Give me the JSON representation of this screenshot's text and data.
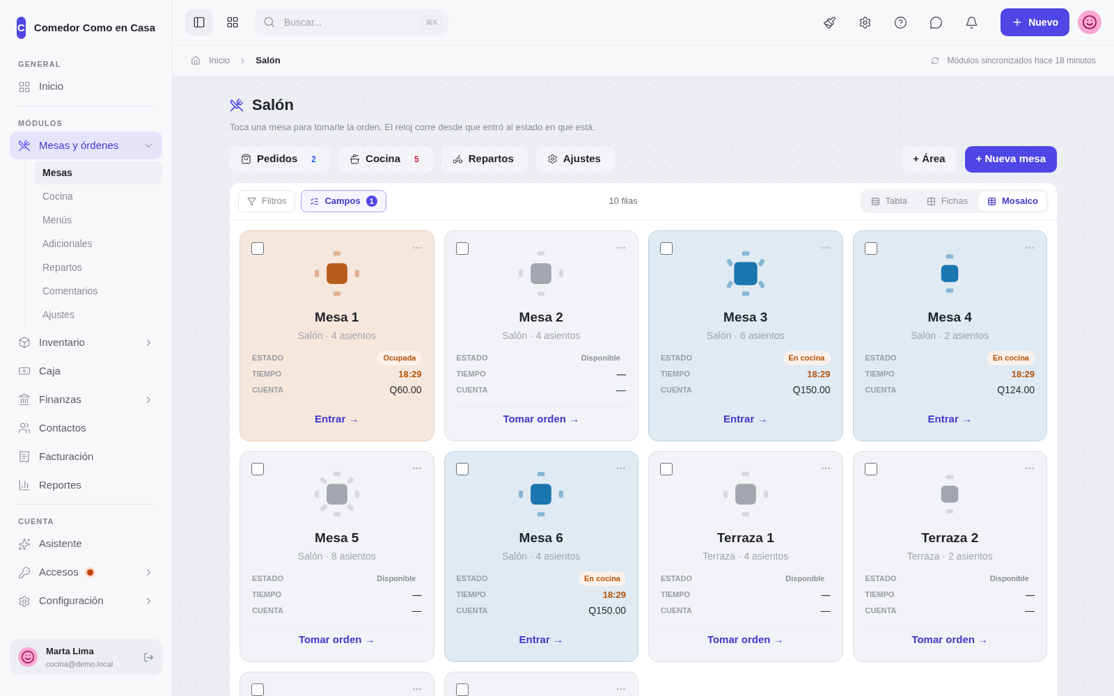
{
  "sidebar": {
    "brand": {
      "letter": "C",
      "name": "Comedor Como en Casa"
    },
    "sections": [
      {
        "title": "GENERAL",
        "items": [
          {
            "label": "Inicio",
            "selected": false,
            "alert": false
          }
        ]
      },
      {
        "title": "MÓDULOS",
        "items": [
          {
            "label": "Mesas y órdenes",
            "selected": true,
            "expanded": true,
            "alert": false,
            "children": [
              {
                "label": "Mesas",
                "selected": true
              },
              {
                "label": "Cocina",
                "selected": false
              },
              {
                "label": "Menús",
                "selected": false
              },
              {
                "label": "Adicionales",
                "selected": false
              },
              {
                "label": "Repartos",
                "selected": false
              },
              {
                "label": "Comentarios",
                "selected": false
              },
              {
                "label": "Ajustes",
                "selected": false
              }
            ]
          },
          {
            "label": "Inventario",
            "selected": false,
            "expanded": false,
            "alert": false
          },
          {
            "label": "Caja",
            "selected": false,
            "alert": false
          },
          {
            "label": "Finanzas",
            "selected": false,
            "expanded": false,
            "alert": false
          },
          {
            "label": "Contactos",
            "selected": false,
            "alert": false
          },
          {
            "label": "Facturación",
            "selected": false,
            "alert": false
          },
          {
            "label": "Reportes",
            "selected": false,
            "alert": false
          }
        ]
      },
      {
        "title": "CUENTA",
        "items": [
          {
            "label": "Asistente",
            "selected": false,
            "alert": false
          },
          {
            "label": "Accesos",
            "selected": false,
            "expanded": false,
            "alert": true
          },
          {
            "label": "Configuración",
            "selected": false,
            "expanded": false,
            "alert": false
          }
        ]
      }
    ],
    "user": {
      "name": "Marta Lima",
      "email": "cocina@demo.local"
    }
  },
  "topbar": {
    "search": {
      "placeholder": "Buscar...",
      "shortcut": "⌘K"
    },
    "new_button": "Nuevo"
  },
  "breadcrumb": [
    "Inicio",
    "Salón"
  ],
  "sync_status": "Módulos sincronizados hace 18 minutos",
  "page": {
    "title": "Salón",
    "subtitle": "Toca una mesa para tomarle la orden. El reloj corre desde que entró al estado en que está."
  },
  "shortcuts": [
    {
      "label": "Pedidos",
      "count": "2",
      "color": "#2563eb"
    },
    {
      "label": "Cocina",
      "count": "5",
      "color": "#e11d48"
    },
    {
      "label": "Repartos"
    },
    {
      "label": "Ajustes"
    }
  ],
  "actions": {
    "area": "+ Área",
    "new_table": "+ Nueva mesa"
  },
  "toolbar": {
    "filters": "Filtros",
    "fields": "Campos",
    "fields_count": "1",
    "row_count": "10 filas",
    "views": [
      {
        "label": "Tabla",
        "selected": false
      },
      {
        "label": "Fichas",
        "selected": false
      },
      {
        "label": "Mosaico",
        "selected": true
      }
    ]
  },
  "cards": [
    {
      "title": "Mesa 1",
      "subtitle": "Salón · 4 asientos",
      "kind": "occupied",
      "table": {
        "kind": "four"
      },
      "checked": false,
      "fields": [
        {
          "label": "ESTADO",
          "value": "Ocupada"
        },
        {
          "label": "TIEMPO",
          "value": "18:29"
        },
        {
          "label": "CUENTA",
          "value": "Q60.00"
        }
      ],
      "action": "Entrar →"
    },
    {
      "title": "Mesa 2",
      "subtitle": "Salón · 4 asientos",
      "kind": "available",
      "table": {
        "kind": "four"
      },
      "checked": false,
      "fields": [
        {
          "label": "ESTADO",
          "value": "Disponible"
        },
        {
          "label": "TIEMPO",
          "value": "—"
        },
        {
          "label": "CUENTA",
          "value": "—"
        }
      ],
      "action": "Tomar orden →"
    },
    {
      "title": "Mesa 3",
      "subtitle": "Salón · 6 asientos",
      "kind": "kitchen",
      "table": {
        "kind": "six"
      },
      "checked": false,
      "fields": [
        {
          "label": "ESTADO",
          "value": "En cocina"
        },
        {
          "label": "TIEMPO",
          "value": "18:29"
        },
        {
          "label": "CUENTA",
          "value": "Q150.00"
        }
      ],
      "action": "Entrar →"
    },
    {
      "title": "Mesa 4",
      "subtitle": "Salón · 2 asientos",
      "kind": "kitchen",
      "table": {
        "kind": "two"
      },
      "checked": false,
      "fields": [
        {
          "label": "ESTADO",
          "value": "En cocina"
        },
        {
          "label": "TIEMPO",
          "value": "18:29"
        },
        {
          "label": "CUENTA",
          "value": "Q124.00"
        }
      ],
      "action": "Entrar →"
    },
    {
      "title": "Mesa 5",
      "subtitle": "Salón · 8 asientos",
      "kind": "available",
      "table": {
        "kind": "eight"
      },
      "checked": false,
      "fields": [
        {
          "label": "ESTADO",
          "value": "Disponible"
        },
        {
          "label": "TIEMPO",
          "value": "—"
        },
        {
          "label": "CUENTA",
          "value": "—"
        }
      ],
      "action": "Tomar orden →"
    },
    {
      "title": "Mesa 6",
      "subtitle": "Salón · 4 asientos",
      "kind": "kitchen",
      "table": {
        "kind": "four"
      },
      "checked": false,
      "fields": [
        {
          "label": "ESTADO",
          "value": "En cocina"
        },
        {
          "label": "TIEMPO",
          "value": "18:29"
        },
        {
          "label": "CUENTA",
          "value": "Q150.00"
        }
      ],
      "action": "Entrar →"
    },
    {
      "title": "Terraza 1",
      "subtitle": "Terraza · 4 asientos",
      "kind": "available",
      "table": {
        "kind": "four"
      },
      "checked": false,
      "fields": [
        {
          "label": "ESTADO",
          "value": "Disponible"
        },
        {
          "label": "TIEMPO",
          "value": "—"
        },
        {
          "label": "CUENTA",
          "value": "—"
        }
      ],
      "action": "Tomar orden →"
    },
    {
      "title": "Terraza 2",
      "subtitle": "Terraza · 2 asientos",
      "kind": "available",
      "table": {
        "kind": "two"
      },
      "checked": false,
      "fields": [
        {
          "label": "ESTADO",
          "value": "Disponible"
        },
        {
          "label": "TIEMPO",
          "value": "—"
        },
        {
          "label": "CUENTA",
          "value": "—"
        }
      ],
      "action": "Tomar orden →"
    }
  ],
  "partial_cards": [
    {
      "kind": "available",
      "checked": false
    },
    {
      "kind": "available",
      "checked": false
    }
  ]
}
